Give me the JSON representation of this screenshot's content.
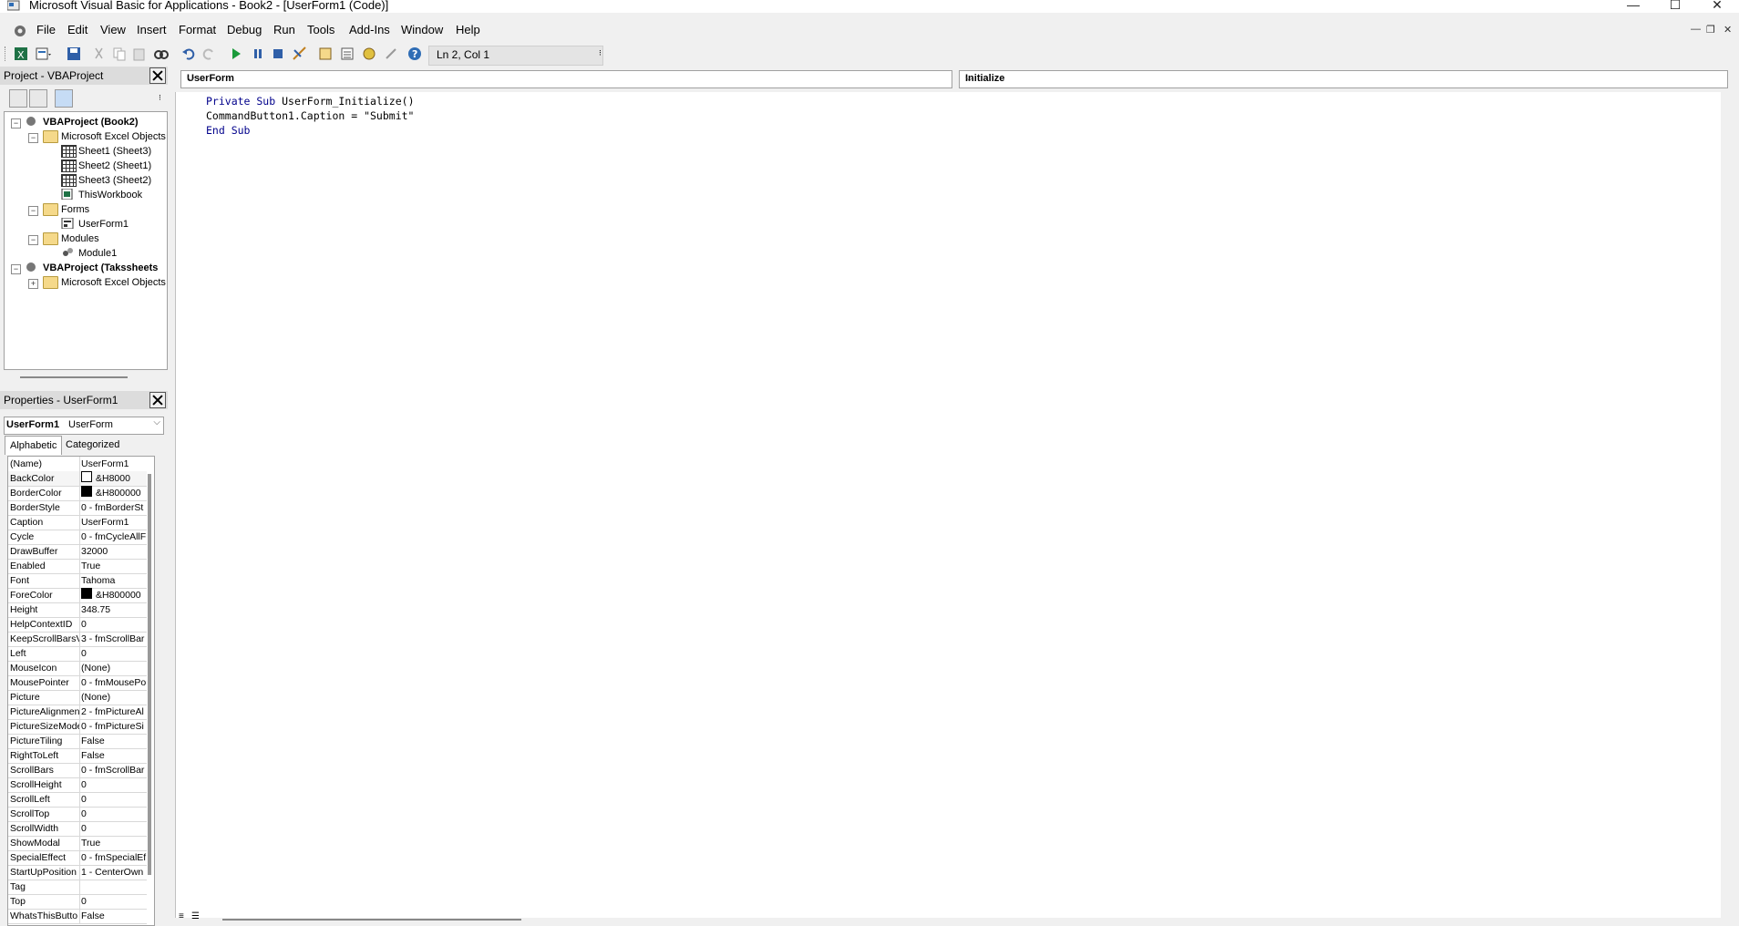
{
  "window": {
    "title": "Microsoft Visual Basic for Applications - Book2 - [UserForm1 (Code)]",
    "minimize": "—",
    "maximize": "☐",
    "close": "✕"
  },
  "menu": [
    "File",
    "Edit",
    "View",
    "Insert",
    "Format",
    "Debug",
    "Run",
    "Tools",
    "Add-Ins",
    "Window",
    "Help"
  ],
  "toolbar": {
    "status": "Ln 2, Col 1"
  },
  "project": {
    "title": "Project - VBAProject",
    "tree": [
      {
        "label": "VBAProject (Book2)",
        "bold": true
      },
      {
        "label": "Microsoft Excel Objects"
      },
      {
        "label": "Sheet1 (Sheet3)"
      },
      {
        "label": "Sheet2 (Sheet1)"
      },
      {
        "label": "Sheet3 (Sheet2)"
      },
      {
        "label": "ThisWorkbook"
      },
      {
        "label": "Forms"
      },
      {
        "label": "UserForm1"
      },
      {
        "label": "Modules"
      },
      {
        "label": "Module1"
      },
      {
        "label": "VBAProject (Takssheets",
        "bold": true
      },
      {
        "label": "Microsoft Excel Objects"
      }
    ]
  },
  "properties": {
    "title": "Properties - UserForm1",
    "object_name": "UserForm1",
    "object_type": "UserForm",
    "tabs": [
      "Alphabetic",
      "Categorized"
    ],
    "rows": [
      [
        "(Name)",
        "UserForm1"
      ],
      [
        "BackColor",
        "&H8000"
      ],
      [
        "BorderColor",
        "&H800000"
      ],
      [
        "BorderStyle",
        "0 - fmBorderSt"
      ],
      [
        "Caption",
        "UserForm1"
      ],
      [
        "Cycle",
        "0 - fmCycleAllF"
      ],
      [
        "DrawBuffer",
        "32000"
      ],
      [
        "Enabled",
        "True"
      ],
      [
        "Font",
        "Tahoma"
      ],
      [
        "ForeColor",
        "&H800000"
      ],
      [
        "Height",
        "348.75"
      ],
      [
        "HelpContextID",
        "0"
      ],
      [
        "KeepScrollBarsV",
        "3 - fmScrollBar"
      ],
      [
        "Left",
        "0"
      ],
      [
        "MouseIcon",
        "(None)"
      ],
      [
        "MousePointer",
        "0 - fmMousePo"
      ],
      [
        "Picture",
        "(None)"
      ],
      [
        "PictureAlignmen",
        "2 - fmPictureAl"
      ],
      [
        "PictureSizeMode",
        "0 - fmPictureSi"
      ],
      [
        "PictureTiling",
        "False"
      ],
      [
        "RightToLeft",
        "False"
      ],
      [
        "ScrollBars",
        "0 - fmScrollBar"
      ],
      [
        "ScrollHeight",
        "0"
      ],
      [
        "ScrollLeft",
        "0"
      ],
      [
        "ScrollTop",
        "0"
      ],
      [
        "ScrollWidth",
        "0"
      ],
      [
        "ShowModal",
        "True"
      ],
      [
        "SpecialEffect",
        "0 - fmSpecialEf"
      ],
      [
        "StartUpPosition",
        "1 - CenterOwn"
      ],
      [
        "Tag",
        ""
      ],
      [
        "Top",
        "0"
      ],
      [
        "WhatsThisButto",
        "False"
      ]
    ]
  },
  "code": {
    "object_combo": "UserForm",
    "proc_combo": "Initialize",
    "lines": [
      "Private Sub UserForm_Initialize()",
      "CommandButton1.Caption = \"Submit\"",
      "End Sub"
    ]
  }
}
